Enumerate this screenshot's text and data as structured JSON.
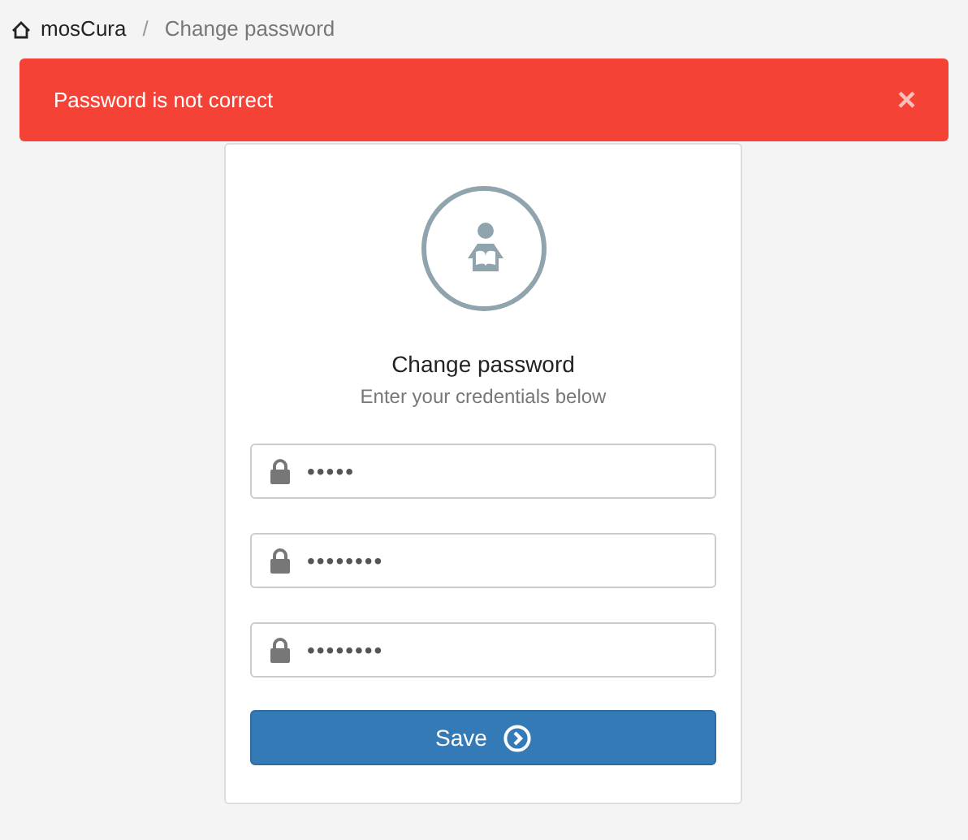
{
  "breadcrumb": {
    "home": "mosCura",
    "separator": "/",
    "current": "Change password"
  },
  "alert": {
    "message": "Password is not correct",
    "close": "×"
  },
  "card": {
    "title": "Change password",
    "subtitle": "Enter your credentials below",
    "fields": [
      {
        "value": "•••••"
      },
      {
        "value": "••••••••"
      },
      {
        "value": "••••••••"
      }
    ],
    "button": "Save"
  }
}
